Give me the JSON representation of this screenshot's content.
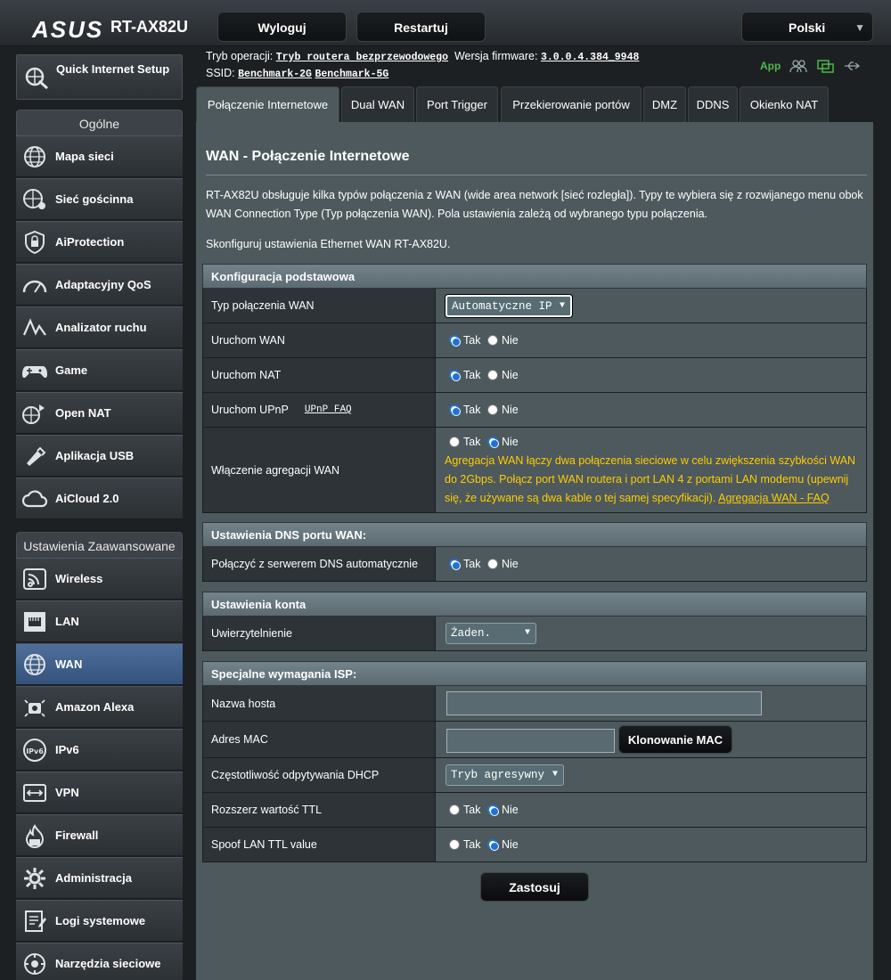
{
  "header": {
    "brand": "ASUS",
    "model": "RT-AX82U",
    "logout": "Wyloguj",
    "reboot": "Restartuj",
    "language": "Polski"
  },
  "info": {
    "mode_label": "Tryb operacji:",
    "mode_value": "Tryb routera bezprzewodowego",
    "fw_label": "Wersja firmware:",
    "fw_value": "3.0.0.4.384_9948",
    "ssid_label": "SSID:",
    "ssid_1": "Benchmark-2G",
    "ssid_2": "Benchmark-5G",
    "app": "App"
  },
  "sidebar": {
    "qis": "Quick Internet Setup",
    "general_header": "Ogólne",
    "general": [
      "Mapa sieci",
      "Sieć gościnna",
      "AiProtection",
      "Adaptacyjny QoS",
      "Analizator ruchu",
      "Game",
      "Open NAT",
      "Aplikacja USB",
      "AiCloud 2.0"
    ],
    "advanced_header": "Ustawienia Zaawansowane",
    "advanced": [
      "Wireless",
      "LAN",
      "WAN",
      "Amazon Alexa",
      "IPv6",
      "VPN",
      "Firewall",
      "Administracja",
      "Logi systemowe",
      "Narzędzia sieciowe"
    ]
  },
  "tabs": [
    "Połączenie Internetowe",
    "Dual WAN",
    "Port Trigger",
    "Przekierowanie portów",
    "DMZ",
    "DDNS",
    "Okienko NAT"
  ],
  "page": {
    "title": "WAN - Połączenie Internetowe",
    "desc": "RT-AX82U obsługuje kilka typów połączenia z WAN (wide area network [sieć rozległa]). Typy te wybiera się z rozwijanego menu obok WAN Connection Type (Typ połączenia WAN). Pola ustawienia zależą od wybranego typu połączenia.",
    "desc2": "Skonfiguruj ustawienia Ethernet WAN RT-AX82U."
  },
  "labels": {
    "yes": "Tak",
    "no": "Nie"
  },
  "basic": {
    "header": "Konfiguracja podstawowa",
    "wan_type_label": "Typ połączenia WAN",
    "wan_type_value": "Automatyczne IP",
    "enable_wan": "Uruchom WAN",
    "enable_nat": "Uruchom NAT",
    "enable_upnp": "Uruchom UPnP",
    "upnp_faq": "UPnP FAQ",
    "aggregation": "Włączenie agregacji WAN",
    "aggregation_note": "Agregacja WAN łączy dwa połączenia sieciowe w celu zwiększenia szybkości WAN do 2Gbps. Połącz port WAN routera i port LAN 4 z portami LAN modemu (upewnij się, że używane są dwa kable o tej samej specyfikacji).",
    "aggregation_faq": "Agregacja WAN - FAQ"
  },
  "dns": {
    "header": "Ustawienia DNS portu WAN:",
    "auto_label": "Połączyć z serwerem DNS automatycznie"
  },
  "account": {
    "header": "Ustawienia konta",
    "auth_label": "Uwierzytelnienie",
    "auth_value": "Żaden."
  },
  "isp": {
    "header": "Specjalne wymagania ISP:",
    "hostname": "Nazwa hosta",
    "mac": "Adres MAC",
    "clone_mac": "Klonowanie MAC",
    "dhcp_freq": "Częstotliwość odpytywania DHCP",
    "dhcp_value": "Tryb agresywny",
    "ttl": "Rozszerz wartość TTL",
    "spoof_ttl": "Spoof LAN TTL value"
  },
  "apply": "Zastosuj",
  "colors": {
    "accent": "#1e73d8",
    "warning": "#ffcc00",
    "app_green": "#4db848"
  }
}
